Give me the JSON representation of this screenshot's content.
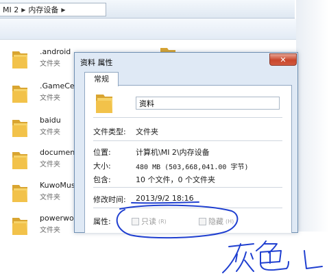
{
  "window": {
    "breadcrumb": [
      "MI 2",
      "内存设备"
    ]
  },
  "files": [
    {
      "name": ".android",
      "type": "文件夹"
    },
    {
      "name": ".GameCen",
      "type": "文件夹"
    },
    {
      "name": "baidu",
      "type": "文件夹"
    },
    {
      "name": "document",
      "type": "文件夹"
    },
    {
      "name": "KuwoMusi",
      "type": "文件夹"
    },
    {
      "name": "powerwor",
      "type": "文件夹"
    }
  ],
  "dialog": {
    "title": "资料 属性",
    "close_glyph": "✕",
    "tab_general": "常规",
    "folder_name": "资料",
    "type_label": "文件类型:",
    "type_value": "文件夹",
    "location_label": "位置:",
    "location_value": "计算机\\MI 2\\内存设备",
    "size_label": "大小:",
    "size_value": "480 MB (503,668,041.00 字节)",
    "contains_label": "包含:",
    "contains_value": "10 个文件，0 个文件夹",
    "modified_label": "修改时间:",
    "modified_value": "2013/9/2 18:16",
    "attributes_label": "属性:",
    "readonly_label": "只读",
    "readonly_key": "(R)",
    "hidden_label": "隐藏",
    "hidden_key": "(H)"
  },
  "annotation_color": "#1f3fd0",
  "colors": {
    "folder_body": "#f2c24a",
    "folder_back": "#d9a531",
    "dialog_frame": "#dfe9f5",
    "close_button": "#c9462b"
  }
}
